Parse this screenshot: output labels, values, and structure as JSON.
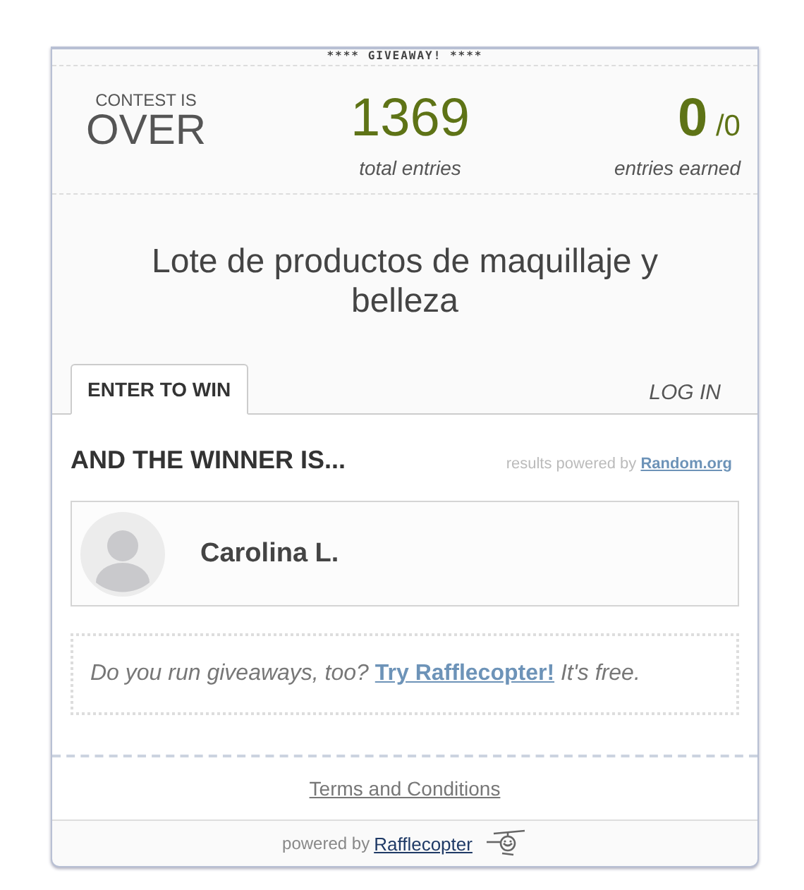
{
  "banner": "**** GIVEAWAY! ****",
  "status": {
    "label": "CONTEST IS",
    "value": "OVER"
  },
  "stats": [
    {
      "kind": "total",
      "value": "1369",
      "caption": "total entries"
    },
    {
      "kind": "earned",
      "value": "0",
      "of": "/0",
      "caption": "entries earned"
    }
  ],
  "prize_title": "Lote de productos de maquillaje y belleza",
  "tabs": [
    {
      "label": "ENTER TO WIN",
      "selected": true
    },
    {
      "label": "LOG IN",
      "selected": false
    }
  ],
  "winner_heading": "AND THE WINNER IS...",
  "results_credit": {
    "text": "results powered by",
    "link": "Random.org"
  },
  "winner": {
    "name": "Carolina L."
  },
  "promo": {
    "before": "Do you run giveaways, too?",
    "link": "Try Rafflecopter!",
    "after": "It's free."
  },
  "terms_link": "Terms and Conditions",
  "footer": {
    "text": "powered by",
    "link": "Rafflecopter"
  }
}
